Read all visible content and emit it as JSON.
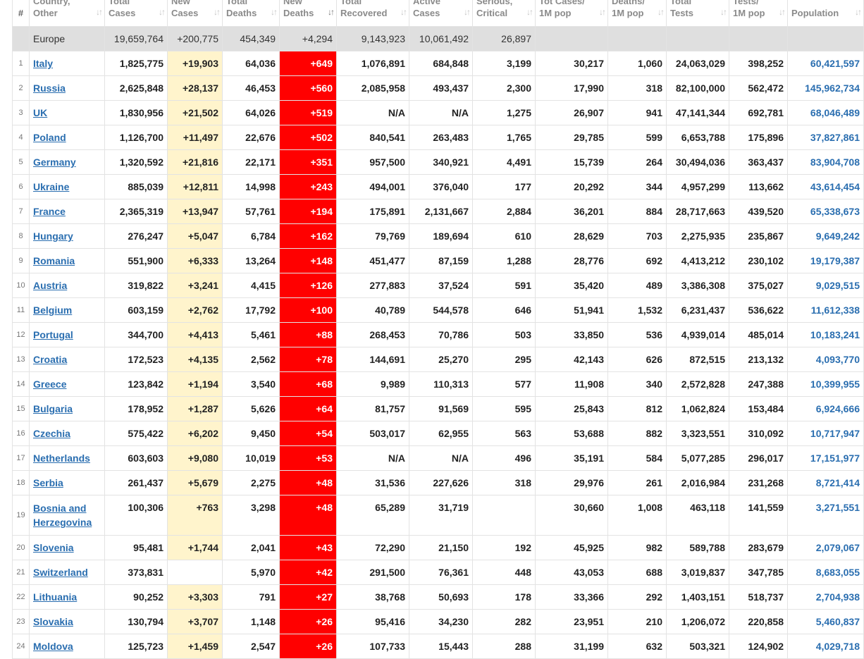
{
  "headers": [
    {
      "label1": "#",
      "label2": ""
    },
    {
      "label1": "Country,",
      "label2": "Other"
    },
    {
      "label1": "Total",
      "label2": "Cases"
    },
    {
      "label1": "New",
      "label2": "Cases"
    },
    {
      "label1": "Total",
      "label2": "Deaths"
    },
    {
      "label1": "New",
      "label2": "Deaths"
    },
    {
      "label1": "Total",
      "label2": "Recovered"
    },
    {
      "label1": "Active",
      "label2": "Cases"
    },
    {
      "label1": "Serious,",
      "label2": "Critical"
    },
    {
      "label1": "Tot Cases/",
      "label2": "1M pop"
    },
    {
      "label1": "Deaths/",
      "label2": "1M pop"
    },
    {
      "label1": "Total",
      "label2": "Tests"
    },
    {
      "label1": "Tests/",
      "label2": "1M pop"
    },
    {
      "label1": "Population",
      "label2": ""
    }
  ],
  "region": {
    "name": "Europe",
    "total_cases": "19,659,764",
    "new_cases": "+200,775",
    "total_deaths": "454,349",
    "new_deaths": "+4,294",
    "total_recovered": "9,143,923",
    "active_cases": "10,061,492",
    "serious": "26,897"
  },
  "rows": [
    {
      "idx": "1",
      "country": "Italy",
      "total_cases": "1,825,775",
      "new_cases": "+19,903",
      "total_deaths": "64,036",
      "new_deaths": "+649",
      "recovered": "1,076,891",
      "active": "684,848",
      "serious": "3,199",
      "cases_1m": "30,217",
      "deaths_1m": "1,060",
      "tests": "24,063,029",
      "tests_1m": "398,252",
      "population": "60,421,597"
    },
    {
      "idx": "2",
      "country": "Russia",
      "total_cases": "2,625,848",
      "new_cases": "+28,137",
      "total_deaths": "46,453",
      "new_deaths": "+560",
      "recovered": "2,085,958",
      "active": "493,437",
      "serious": "2,300",
      "cases_1m": "17,990",
      "deaths_1m": "318",
      "tests": "82,100,000",
      "tests_1m": "562,472",
      "population": "145,962,734"
    },
    {
      "idx": "3",
      "country": "UK",
      "total_cases": "1,830,956",
      "new_cases": "+21,502",
      "total_deaths": "64,026",
      "new_deaths": "+519",
      "recovered": "N/A",
      "active": "N/A",
      "serious": "1,275",
      "cases_1m": "26,907",
      "deaths_1m": "941",
      "tests": "47,141,344",
      "tests_1m": "692,781",
      "population": "68,046,489"
    },
    {
      "idx": "4",
      "country": "Poland",
      "total_cases": "1,126,700",
      "new_cases": "+11,497",
      "total_deaths": "22,676",
      "new_deaths": "+502",
      "recovered": "840,541",
      "active": "263,483",
      "serious": "1,765",
      "cases_1m": "29,785",
      "deaths_1m": "599",
      "tests": "6,653,788",
      "tests_1m": "175,896",
      "population": "37,827,861"
    },
    {
      "idx": "5",
      "country": "Germany",
      "total_cases": "1,320,592",
      "new_cases": "+21,816",
      "total_deaths": "22,171",
      "new_deaths": "+351",
      "recovered": "957,500",
      "active": "340,921",
      "serious": "4,491",
      "cases_1m": "15,739",
      "deaths_1m": "264",
      "tests": "30,494,036",
      "tests_1m": "363,437",
      "population": "83,904,708"
    },
    {
      "idx": "6",
      "country": "Ukraine",
      "total_cases": "885,039",
      "new_cases": "+12,811",
      "total_deaths": "14,998",
      "new_deaths": "+243",
      "recovered": "494,001",
      "active": "376,040",
      "serious": "177",
      "cases_1m": "20,292",
      "deaths_1m": "344",
      "tests": "4,957,299",
      "tests_1m": "113,662",
      "population": "43,614,454"
    },
    {
      "idx": "7",
      "country": "France",
      "total_cases": "2,365,319",
      "new_cases": "+13,947",
      "total_deaths": "57,761",
      "new_deaths": "+194",
      "recovered": "175,891",
      "active": "2,131,667",
      "serious": "2,884",
      "cases_1m": "36,201",
      "deaths_1m": "884",
      "tests": "28,717,663",
      "tests_1m": "439,520",
      "population": "65,338,673"
    },
    {
      "idx": "8",
      "country": "Hungary",
      "total_cases": "276,247",
      "new_cases": "+5,047",
      "total_deaths": "6,784",
      "new_deaths": "+162",
      "recovered": "79,769",
      "active": "189,694",
      "serious": "610",
      "cases_1m": "28,629",
      "deaths_1m": "703",
      "tests": "2,275,935",
      "tests_1m": "235,867",
      "population": "9,649,242"
    },
    {
      "idx": "9",
      "country": "Romania",
      "total_cases": "551,900",
      "new_cases": "+6,333",
      "total_deaths": "13,264",
      "new_deaths": "+148",
      "recovered": "451,477",
      "active": "87,159",
      "serious": "1,288",
      "cases_1m": "28,776",
      "deaths_1m": "692",
      "tests": "4,413,212",
      "tests_1m": "230,102",
      "population": "19,179,387"
    },
    {
      "idx": "10",
      "country": "Austria",
      "total_cases": "319,822",
      "new_cases": "+3,241",
      "total_deaths": "4,415",
      "new_deaths": "+126",
      "recovered": "277,883",
      "active": "37,524",
      "serious": "591",
      "cases_1m": "35,420",
      "deaths_1m": "489",
      "tests": "3,386,308",
      "tests_1m": "375,027",
      "population": "9,029,515"
    },
    {
      "idx": "11",
      "country": "Belgium",
      "total_cases": "603,159",
      "new_cases": "+2,762",
      "total_deaths": "17,792",
      "new_deaths": "+100",
      "recovered": "40,789",
      "active": "544,578",
      "serious": "646",
      "cases_1m": "51,941",
      "deaths_1m": "1,532",
      "tests": "6,231,437",
      "tests_1m": "536,622",
      "population": "11,612,338"
    },
    {
      "idx": "12",
      "country": "Portugal",
      "total_cases": "344,700",
      "new_cases": "+4,413",
      "total_deaths": "5,461",
      "new_deaths": "+88",
      "recovered": "268,453",
      "active": "70,786",
      "serious": "503",
      "cases_1m": "33,850",
      "deaths_1m": "536",
      "tests": "4,939,014",
      "tests_1m": "485,014",
      "population": "10,183,241"
    },
    {
      "idx": "13",
      "country": "Croatia",
      "total_cases": "172,523",
      "new_cases": "+4,135",
      "total_deaths": "2,562",
      "new_deaths": "+78",
      "recovered": "144,691",
      "active": "25,270",
      "serious": "295",
      "cases_1m": "42,143",
      "deaths_1m": "626",
      "tests": "872,515",
      "tests_1m": "213,132",
      "population": "4,093,770"
    },
    {
      "idx": "14",
      "country": "Greece",
      "total_cases": "123,842",
      "new_cases": "+1,194",
      "total_deaths": "3,540",
      "new_deaths": "+68",
      "recovered": "9,989",
      "active": "110,313",
      "serious": "577",
      "cases_1m": "11,908",
      "deaths_1m": "340",
      "tests": "2,572,828",
      "tests_1m": "247,388",
      "population": "10,399,955"
    },
    {
      "idx": "15",
      "country": "Bulgaria",
      "total_cases": "178,952",
      "new_cases": "+1,287",
      "total_deaths": "5,626",
      "new_deaths": "+64",
      "recovered": "81,757",
      "active": "91,569",
      "serious": "595",
      "cases_1m": "25,843",
      "deaths_1m": "812",
      "tests": "1,062,824",
      "tests_1m": "153,484",
      "population": "6,924,666"
    },
    {
      "idx": "16",
      "country": "Czechia",
      "total_cases": "575,422",
      "new_cases": "+6,202",
      "total_deaths": "9,450",
      "new_deaths": "+54",
      "recovered": "503,017",
      "active": "62,955",
      "serious": "563",
      "cases_1m": "53,688",
      "deaths_1m": "882",
      "tests": "3,323,551",
      "tests_1m": "310,092",
      "population": "10,717,947"
    },
    {
      "idx": "17",
      "country": "Netherlands",
      "total_cases": "603,603",
      "new_cases": "+9,080",
      "total_deaths": "10,019",
      "new_deaths": "+53",
      "recovered": "N/A",
      "active": "N/A",
      "serious": "496",
      "cases_1m": "35,191",
      "deaths_1m": "584",
      "tests": "5,077,285",
      "tests_1m": "296,017",
      "population": "17,151,977"
    },
    {
      "idx": "18",
      "country": "Serbia",
      "total_cases": "261,437",
      "new_cases": "+5,679",
      "total_deaths": "2,275",
      "new_deaths": "+48",
      "recovered": "31,536",
      "active": "227,626",
      "serious": "318",
      "cases_1m": "29,976",
      "deaths_1m": "261",
      "tests": "2,016,984",
      "tests_1m": "231,268",
      "population": "8,721,414"
    },
    {
      "idx": "19",
      "country": "Bosnia and Herzegovina",
      "total_cases": "100,306",
      "new_cases": "+763",
      "total_deaths": "3,298",
      "new_deaths": "+48",
      "recovered": "65,289",
      "active": "31,719",
      "serious": "",
      "cases_1m": "30,660",
      "deaths_1m": "1,008",
      "tests": "463,118",
      "tests_1m": "141,559",
      "population": "3,271,551"
    },
    {
      "idx": "20",
      "country": "Slovenia",
      "total_cases": "95,481",
      "new_cases": "+1,744",
      "total_deaths": "2,041",
      "new_deaths": "+43",
      "recovered": "72,290",
      "active": "21,150",
      "serious": "192",
      "cases_1m": "45,925",
      "deaths_1m": "982",
      "tests": "589,788",
      "tests_1m": "283,679",
      "population": "2,079,067"
    },
    {
      "idx": "21",
      "country": "Switzerland",
      "total_cases": "373,831",
      "new_cases": "",
      "total_deaths": "5,970",
      "new_deaths": "+42",
      "recovered": "291,500",
      "active": "76,361",
      "serious": "448",
      "cases_1m": "43,053",
      "deaths_1m": "688",
      "tests": "3,019,837",
      "tests_1m": "347,785",
      "population": "8,683,055"
    },
    {
      "idx": "22",
      "country": "Lithuania",
      "total_cases": "90,252",
      "new_cases": "+3,303",
      "total_deaths": "791",
      "new_deaths": "+27",
      "recovered": "38,768",
      "active": "50,693",
      "serious": "178",
      "cases_1m": "33,366",
      "deaths_1m": "292",
      "tests": "1,403,151",
      "tests_1m": "518,737",
      "population": "2,704,938"
    },
    {
      "idx": "23",
      "country": "Slovakia",
      "total_cases": "130,794",
      "new_cases": "+3,707",
      "total_deaths": "1,148",
      "new_deaths": "+26",
      "recovered": "95,416",
      "active": "34,230",
      "serious": "282",
      "cases_1m": "23,951",
      "deaths_1m": "210",
      "tests": "1,206,072",
      "tests_1m": "220,858",
      "population": "5,460,837"
    },
    {
      "idx": "24",
      "country": "Moldova",
      "total_cases": "125,723",
      "new_cases": "+1,459",
      "total_deaths": "2,547",
      "new_deaths": "+26",
      "recovered": "107,733",
      "active": "15,443",
      "serious": "288",
      "cases_1m": "31,199",
      "deaths_1m": "632",
      "tests": "503,321",
      "tests_1m": "124,902",
      "population": "4,029,718"
    }
  ],
  "colors": {
    "new_cases_bg": "#fff4cc",
    "new_deaths_bg": "#ff0000",
    "region_row_bg": "#dfdfdf",
    "link": "#2a6eb0"
  }
}
